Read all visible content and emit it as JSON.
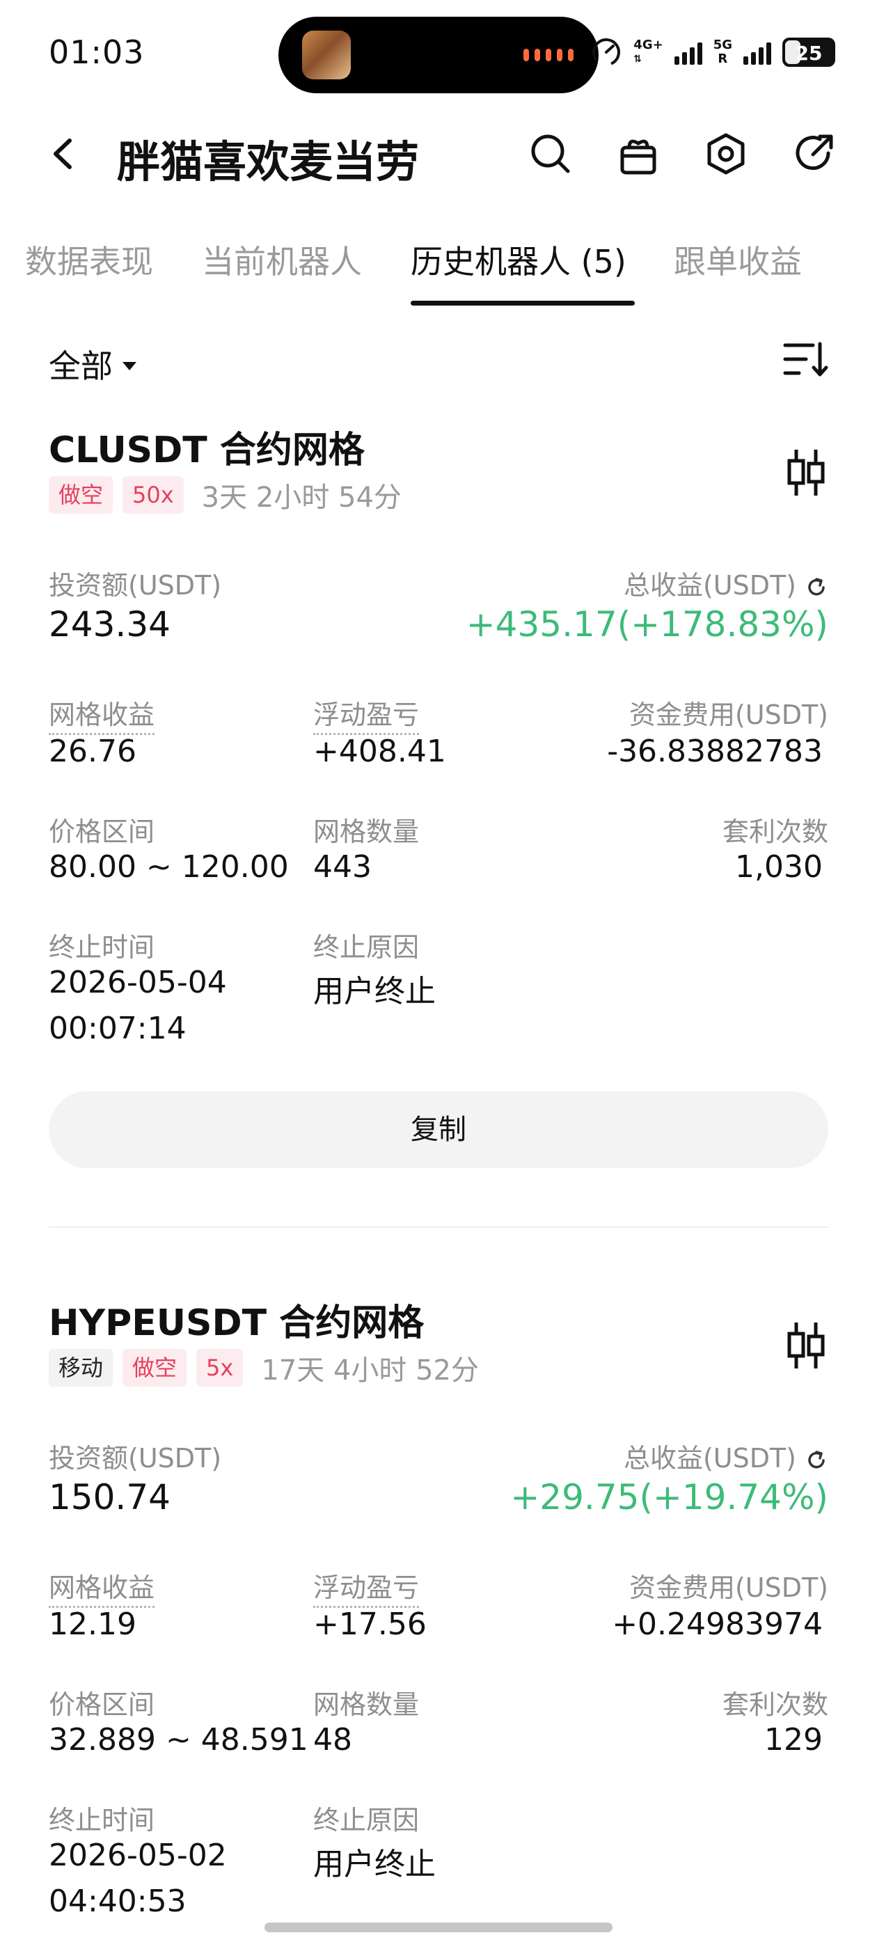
{
  "status_bar": {
    "time": "01:03",
    "net_top": "4G+",
    "net_bottom_left": "5G",
    "net_r": "R",
    "battery": "25"
  },
  "header": {
    "title": "胖猫喜欢麦当劳",
    "icons": [
      "back-icon",
      "search-icon",
      "gift-icon",
      "settings-icon",
      "share-icon"
    ]
  },
  "tabs": [
    {
      "label": "数据表现",
      "active": false
    },
    {
      "label": "当前机器人",
      "active": false
    },
    {
      "label": "历史机器人 (5)",
      "active": true
    },
    {
      "label": "跟单收益",
      "active": false
    }
  ],
  "filter": {
    "label": "全部"
  },
  "bots": [
    {
      "title": "CLUSDT 合约网格",
      "tags": [
        {
          "label": "做空",
          "style": "red"
        },
        {
          "label": "50x",
          "style": "red"
        }
      ],
      "duration": "3天 2小时 54分",
      "invest_label": "投资额(USDT)",
      "invest_value": "243.34",
      "profit_label": "总收益(USDT)",
      "profit_value": "+435.17(+178.83%)",
      "grid_profit_label": "网格收益",
      "grid_profit_value": "26.76",
      "float_pnl_label": "浮动盈亏",
      "float_pnl_value": "+408.41",
      "funding_label": "资金费用(USDT)",
      "funding_value": "-36.83882783",
      "range_label": "价格区间",
      "range_value": "80.00 ~ 120.00",
      "grid_count_label": "网格数量",
      "grid_count_value": "443",
      "arb_label": "套利次数",
      "arb_value": "1,030",
      "end_time_label": "终止时间",
      "end_date": "2026-05-04",
      "end_time": "00:07:14",
      "end_reason_label": "终止原因",
      "end_reason_value": "用户终止",
      "copy_label": "复制"
    },
    {
      "title": "HYPEUSDT 合约网格",
      "tags": [
        {
          "label": "移动",
          "style": "gray"
        },
        {
          "label": "做空",
          "style": "red"
        },
        {
          "label": "5x",
          "style": "red"
        }
      ],
      "duration": "17天 4小时 52分",
      "invest_label": "投资额(USDT)",
      "invest_value": "150.74",
      "profit_label": "总收益(USDT)",
      "profit_value": "+29.75(+19.74%)",
      "grid_profit_label": "网格收益",
      "grid_profit_value": "12.19",
      "float_pnl_label": "浮动盈亏",
      "float_pnl_value": "+17.56",
      "funding_label": "资金费用(USDT)",
      "funding_value": "+0.24983974",
      "range_label": "价格区间",
      "range_value": "32.889 ~ 48.591",
      "grid_count_label": "网格数量",
      "grid_count_value": "48",
      "arb_label": "套利次数",
      "arb_value": "129",
      "end_time_label": "终止时间",
      "end_date": "2026-05-02",
      "end_time": "04:40:53",
      "end_reason_label": "终止原因",
      "end_reason_value": "用户终止"
    }
  ],
  "colors": {
    "profit_green": "#3dbb78",
    "short_red": "#e4405f",
    "muted_text": "#8e8e8e"
  }
}
